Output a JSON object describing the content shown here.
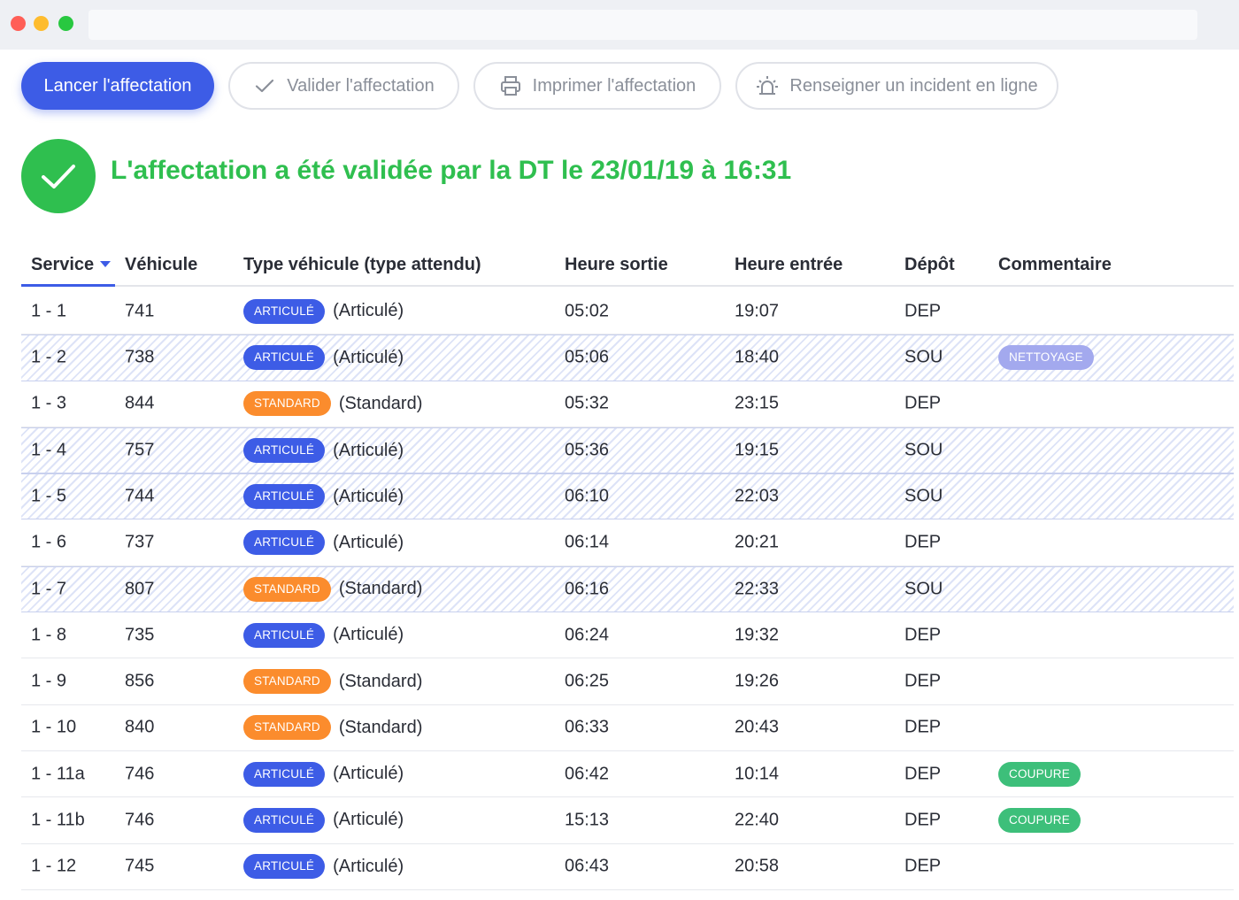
{
  "toolbar": {
    "launch_label": "Lancer l'affectation",
    "validate_label": "Valider l'affectation",
    "print_label": "Imprimer l'affectation",
    "incident_label": "Renseigner un incident en ligne"
  },
  "status": {
    "message": "L'affectation a été validée par la DT le 23/01/19 à 16:31"
  },
  "table": {
    "headers": {
      "service": "Service",
      "vehicle": "Véhicule",
      "type": "Type véhicule (type attendu)",
      "out": "Heure sortie",
      "in": "Heure entrée",
      "depot": "Dépôt",
      "comment": "Commentaire"
    },
    "rows": [
      {
        "service": "1 - 1",
        "vehicle": "741",
        "badge": "ARTICULÉ",
        "expected": "(Articulé)",
        "out": "05:02",
        "in": "19:07",
        "depot": "DEP",
        "comment": ""
      },
      {
        "service": "1 - 2",
        "vehicle": "738",
        "badge": "ARTICULÉ",
        "expected": "(Articulé)",
        "out": "05:06",
        "in": "18:40",
        "depot": "SOU",
        "comment": "NETTOYAGE"
      },
      {
        "service": "1 - 3",
        "vehicle": "844",
        "badge": "STANDARD",
        "expected": "(Standard)",
        "out": "05:32",
        "in": "23:15",
        "depot": "DEP",
        "comment": ""
      },
      {
        "service": "1 - 4",
        "vehicle": "757",
        "badge": "ARTICULÉ",
        "expected": "(Articulé)",
        "out": "05:36",
        "in": "19:15",
        "depot": "SOU",
        "comment": ""
      },
      {
        "service": "1 - 5",
        "vehicle": "744",
        "badge": "ARTICULÉ",
        "expected": "(Articulé)",
        "out": "06:10",
        "in": "22:03",
        "depot": "SOU",
        "comment": ""
      },
      {
        "service": "1 - 6",
        "vehicle": "737",
        "badge": "ARTICULÉ",
        "expected": "(Articulé)",
        "out": "06:14",
        "in": "20:21",
        "depot": "DEP",
        "comment": ""
      },
      {
        "service": "1 - 7",
        "vehicle": "807",
        "badge": "STANDARD",
        "expected": "(Standard)",
        "out": "06:16",
        "in": "22:33",
        "depot": "SOU",
        "comment": ""
      },
      {
        "service": "1 - 8",
        "vehicle": "735",
        "badge": "ARTICULÉ",
        "expected": "(Articulé)",
        "out": "06:24",
        "in": "19:32",
        "depot": "DEP",
        "comment": ""
      },
      {
        "service": "1 - 9",
        "vehicle": "856",
        "badge": "STANDARD",
        "expected": "(Standard)",
        "out": "06:25",
        "in": "19:26",
        "depot": "DEP",
        "comment": ""
      },
      {
        "service": "1 - 10",
        "vehicle": "840",
        "badge": "STANDARD",
        "expected": "(Standard)",
        "out": "06:33",
        "in": "20:43",
        "depot": "DEP",
        "comment": ""
      },
      {
        "service": "1 - 11a",
        "vehicle": "746",
        "badge": "ARTICULÉ",
        "expected": "(Articulé)",
        "out": "06:42",
        "in": "10:14",
        "depot": "DEP",
        "comment": "COUPURE"
      },
      {
        "service": "1 - 11b",
        "vehicle": "746",
        "badge": "ARTICULÉ",
        "expected": "(Articulé)",
        "out": "15:13",
        "in": "22:40",
        "depot": "DEP",
        "comment": "COUPURE"
      },
      {
        "service": "1 - 12",
        "vehicle": "745",
        "badge": "ARTICULÉ",
        "expected": "(Articulé)",
        "out": "06:43",
        "in": "20:58",
        "depot": "DEP",
        "comment": ""
      }
    ]
  },
  "colors": {
    "primary": "#3d5ce6",
    "success": "#2fbf4f",
    "standard": "#fb8c2d",
    "nettoyage": "#a3a9ee",
    "coupure": "#3dbf7a"
  },
  "icons": {
    "validate": "check-icon",
    "print": "printer-icon",
    "incident": "alarm-light-icon",
    "status": "check-circle-icon",
    "sort": "caret-down-icon"
  }
}
